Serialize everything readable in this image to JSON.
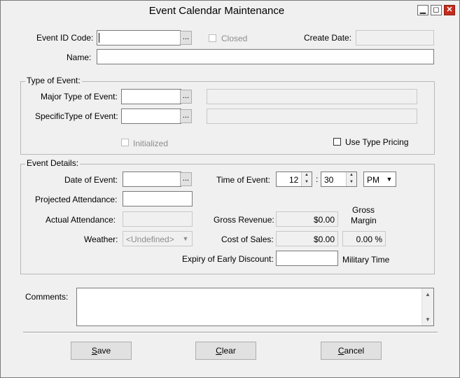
{
  "window": {
    "title": "Event Calendar Maintenance"
  },
  "header": {
    "event_id_label": "Event ID Code:",
    "closed_label": "Closed",
    "create_date_label": "Create Date:",
    "name_label": "Name:",
    "browse_label": "..."
  },
  "type_of_event": {
    "group_title": "Type of Event:",
    "major_label": "Major Type of Event:",
    "specific_label": "SpecificType of Event:",
    "initialized_label": "Initialized",
    "use_type_pricing_label": "Use Type Pricing"
  },
  "event_details": {
    "group_title": "Event Details:",
    "date_label": "Date of Event:",
    "time_label": "Time of Event:",
    "time_hour": "12",
    "time_separator": ":",
    "time_minute": "30",
    "time_ampm": "PM",
    "projected_label": "Projected Attendance:",
    "actual_label": "Actual Attendance:",
    "gross_revenue_label": "Gross Revenue:",
    "gross_revenue_value": "$0.00",
    "gross_margin_label_1": "Gross",
    "gross_margin_label_2": "Margin",
    "weather_label": "Weather:",
    "weather_value": "<Undefined>",
    "cost_label": "Cost of Sales:",
    "cost_value": "$0.00",
    "margin_value": "0.00 %",
    "expiry_label": "Expiry of Early Discount:",
    "military_time_label": "Military Time"
  },
  "comments": {
    "label": "Comments:"
  },
  "buttons": {
    "save_prefix": "S",
    "save_rest": "ave",
    "clear_prefix": "C",
    "clear_rest": "lear",
    "cancel_prefix": "C",
    "cancel_rest": "ancel"
  },
  "icons": {
    "minimize": "minimize-icon",
    "maximize": "maximize-icon",
    "close": "close-icon"
  }
}
